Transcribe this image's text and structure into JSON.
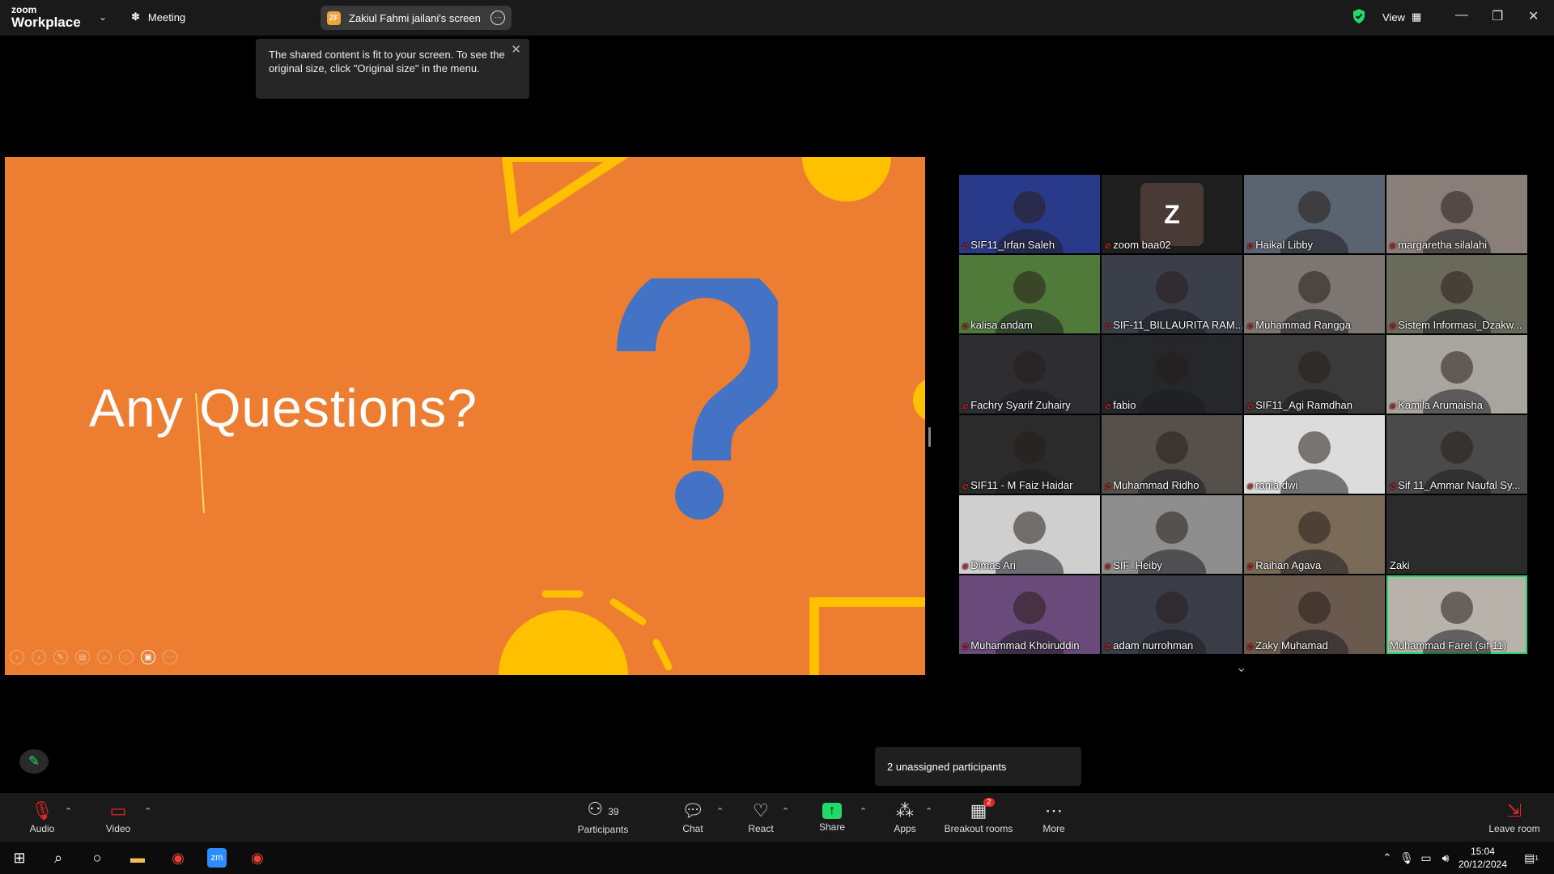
{
  "titlebar": {
    "logo_top": "zoom",
    "logo_bottom": "Workplace",
    "meeting_label": "Meeting",
    "share_initials": "ZF",
    "share_label": "Zakiul Fahmi jailani's screen",
    "view_label": "View"
  },
  "tooltip": {
    "text": "The shared content is fit to your screen. To see the original size, click \"Original size\" in the menu."
  },
  "slide": {
    "title": "Any Questions?"
  },
  "participants": [
    {
      "name": "SIF11_Irfan Saleh",
      "muted": true,
      "bg": "#2a3a8a"
    },
    {
      "name": "zoom baa02",
      "muted": true,
      "bg": "#1e1e1e",
      "avatar_letter": "Z"
    },
    {
      "name": "Haikal Libby",
      "muted": true,
      "bg": "#5a6470"
    },
    {
      "name": "margaretha silalahi",
      "muted": true,
      "bg": "#8a7f78"
    },
    {
      "name": "kalisa andam",
      "muted": true,
      "bg": "#4f7a3a"
    },
    {
      "name": "SIF-11_BILLAURITA RAM...",
      "muted": true,
      "bg": "#3a3f4a"
    },
    {
      "name": "Muhammad Rangga",
      "muted": true,
      "bg": "#7d7570"
    },
    {
      "name": "Sistem Informasi_Dzakw...",
      "muted": true,
      "bg": "#6a6a5a"
    },
    {
      "name": "Fachry Syarif Zuhairy",
      "muted": true,
      "bg": "#2e2e32"
    },
    {
      "name": "fabio",
      "muted": true,
      "bg": "#25272b"
    },
    {
      "name": "SIF11_Agi Ramdhan",
      "muted": true,
      "bg": "#3a3a3a"
    },
    {
      "name": "Kamila Arumaisha",
      "muted": true,
      "bg": "#a8a49e"
    },
    {
      "name": "SIF11 - M Faiz Haidar",
      "muted": true,
      "bg": "#2b2b2b"
    },
    {
      "name": "Muhammad Ridho",
      "muted": true,
      "bg": "#555049"
    },
    {
      "name": "rania dwi",
      "muted": true,
      "bg": "#dcdcdc"
    },
    {
      "name": "Sif 11_Ammar Naufal Sy...",
      "muted": true,
      "bg": "#4a4a4a"
    },
    {
      "name": "Dimas Ari",
      "muted": true,
      "bg": "#cfcfcf"
    },
    {
      "name": "SIF_Heiby",
      "muted": true,
      "bg": "#8e8e8e"
    },
    {
      "name": "Raihan Agava",
      "muted": true,
      "bg": "#7a6a58"
    },
    {
      "name": "Zaki",
      "muted": false,
      "bg": "#2b2b2b"
    },
    {
      "name": "Muhammad Khoiruddin",
      "muted": true,
      "bg": "#6a4a7a"
    },
    {
      "name": "adam nurrohman",
      "muted": true,
      "bg": "#3a3d48"
    },
    {
      "name": "Zaky Muhamad",
      "muted": true,
      "bg": "#6a5a4e"
    },
    {
      "name": "Muhammad Farel (sif 11)",
      "muted": false,
      "bg": "#b7b2aa",
      "active": true
    }
  ],
  "unassigned": {
    "text": "2 unassigned participants"
  },
  "toolbar": {
    "audio": "Audio",
    "video": "Video",
    "participants": "Participants",
    "participants_count": "39",
    "chat": "Chat",
    "react": "React",
    "share": "Share",
    "apps": "Apps",
    "breakout": "Breakout rooms",
    "breakout_badge": "2",
    "more": "More",
    "leave": "Leave room"
  },
  "taskbar": {
    "time": "15:04",
    "date": "20/12/2024",
    "notif": "1"
  },
  "colors": {
    "slide_bg": "#ed7d31",
    "qmark": "#4472c4",
    "accent_green": "#23d96a",
    "mic_off": "#e02828"
  }
}
